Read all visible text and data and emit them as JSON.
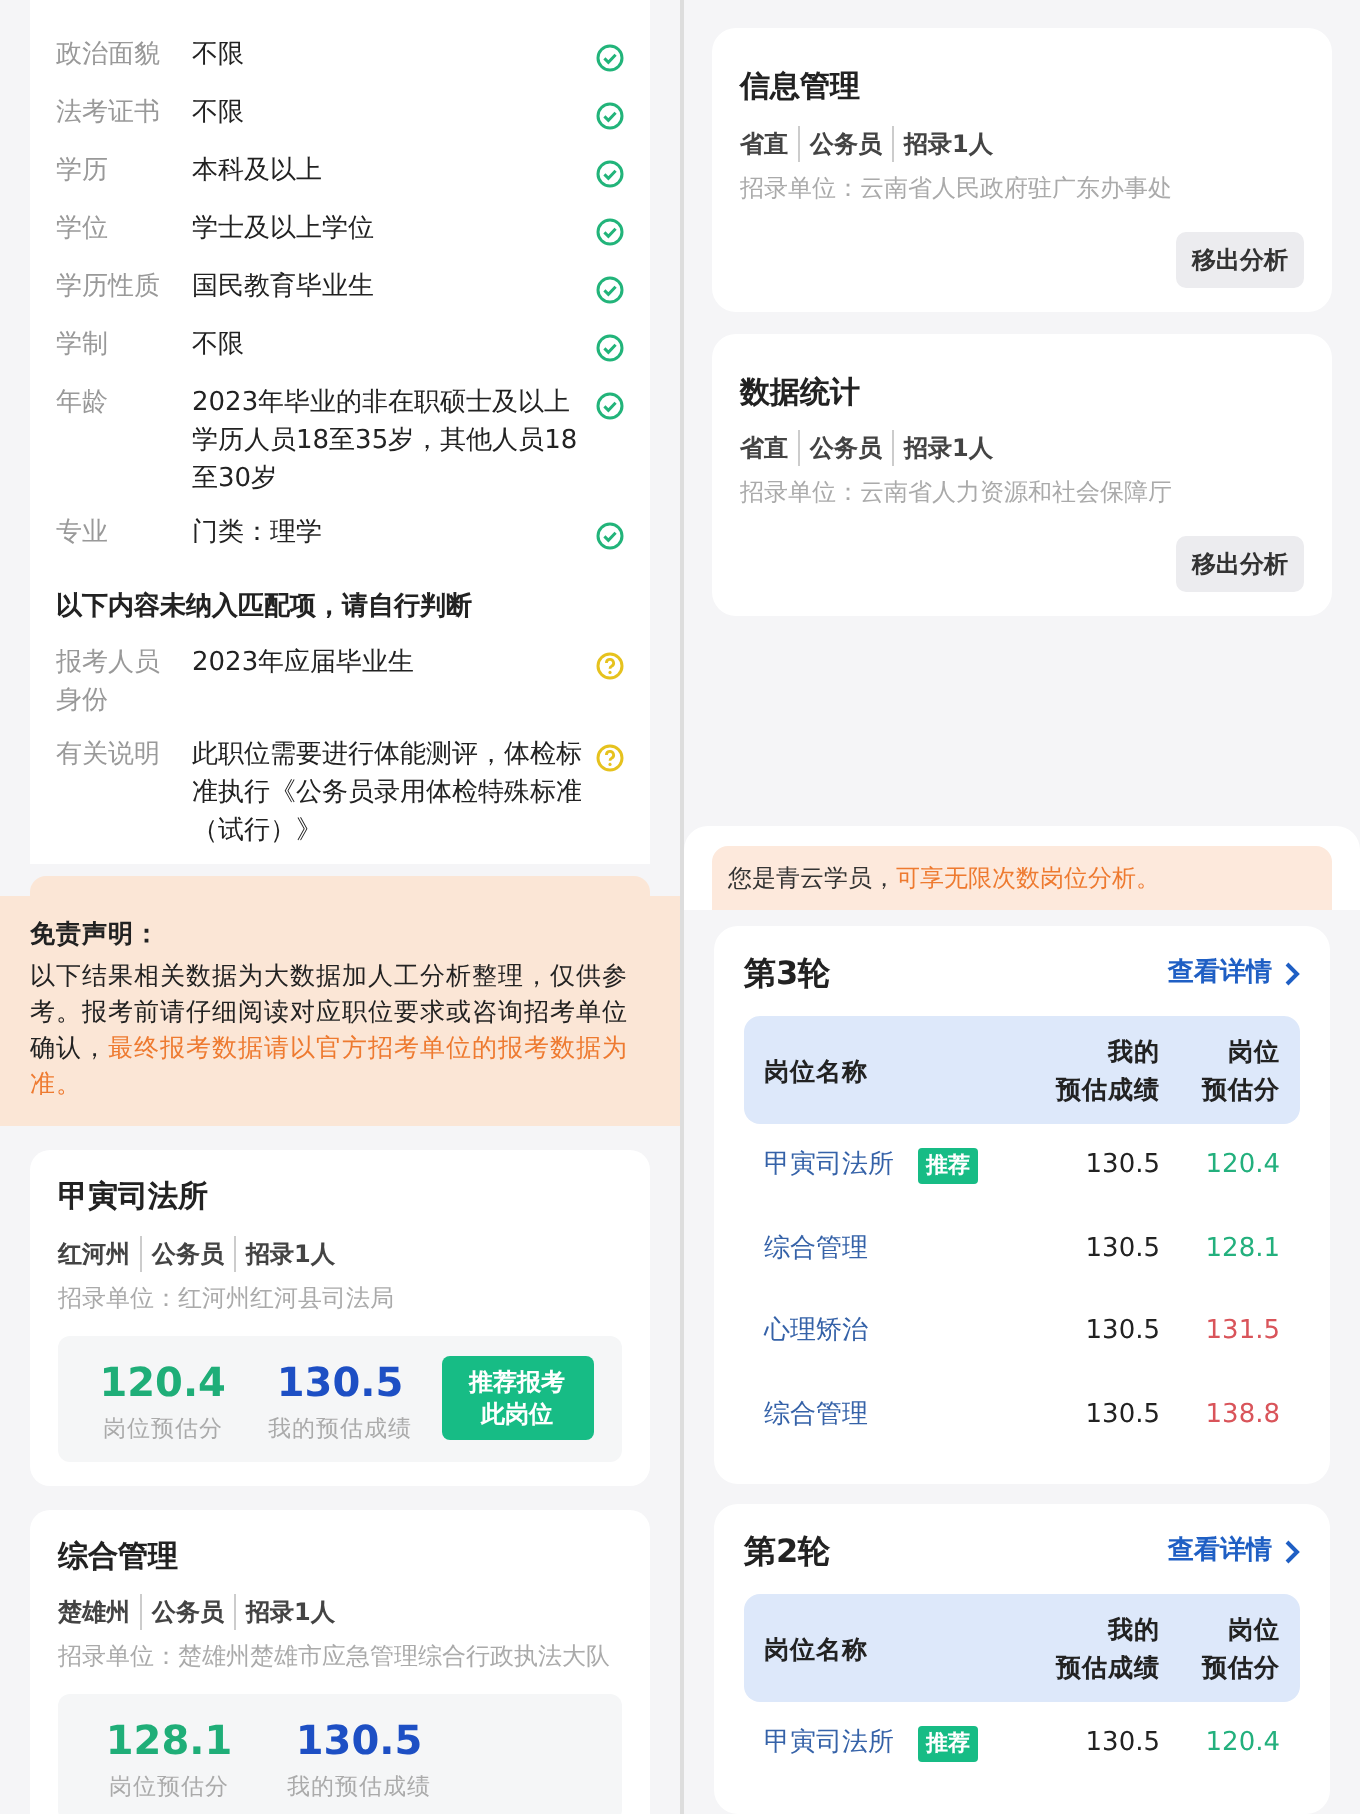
{
  "requirements": {
    "rows": [
      {
        "label": "政治面貌",
        "value": "不限",
        "matched": true
      },
      {
        "label": "法考证书",
        "value": "不限",
        "matched": true
      },
      {
        "label": "学历",
        "value": "本科及以上",
        "matched": true
      },
      {
        "label": "学位",
        "value": "学士及以上学位",
        "matched": true
      },
      {
        "label": "学历性质",
        "value": "国民教育毕业生",
        "matched": true
      },
      {
        "label": "学制",
        "value": "不限",
        "matched": true
      },
      {
        "label": "年龄",
        "value": "2023年毕业的非在职硕士及以上学历人员18至35岁，其他人员18至30岁",
        "matched": true
      },
      {
        "label": "专业",
        "value": "门类：理学",
        "matched": true
      }
    ],
    "notice": "以下内容未纳入匹配项，请自行判断",
    "unmatched_rows": [
      {
        "label": "报考人员身份",
        "value": "2023年应届毕业生",
        "matched": false
      },
      {
        "label": "有关说明",
        "value": "此职位需要进行体能测评，体检标准执行《公务员录用体检特殊标准（试行）》",
        "matched": false
      }
    ]
  },
  "analysis": {
    "cards": [
      {
        "title": "信息管理",
        "tags": [
          "省直",
          "公务员",
          "招录1人"
        ],
        "unit": "招录单位：云南省人民政府驻广东办事处",
        "button": "移出分析"
      },
      {
        "title": "数据统计",
        "tags": [
          "省直",
          "公务员",
          "招录1人"
        ],
        "unit": "招录单位：云南省人力资源和社会保障厅",
        "button": "移出分析"
      }
    ],
    "banner": {
      "text": "您是青云学员，",
      "highlight": "可享无限次数岗位分析。"
    }
  },
  "disclaimer": {
    "title": "免责声明：",
    "text": "以下结果相关数据为大数据加人工分析整理，仅供参考。报考前请仔细阅读对应职位要求或咨询招考单位确认，",
    "highlight": "最终报考数据请以官方招考单位的报考数据为准。"
  },
  "results": [
    {
      "title": "甲寅司法所",
      "tags": [
        "红河州",
        "公务员",
        "招录1人"
      ],
      "unit": "招录单位：红河州红河县司法局",
      "position_score": "120.4",
      "position_label": "岗位预估分",
      "my_score": "130.5",
      "my_label": "我的预估成绩",
      "button": "推荐报考此岗位"
    },
    {
      "title": "综合管理",
      "tags": [
        "楚雄州",
        "公务员",
        "招录1人"
      ],
      "unit": "招录单位：楚雄州楚雄市应急管理综合行政执法大队",
      "position_score": "128.1",
      "position_label": "岗位预估分",
      "my_score": "130.5",
      "my_label": "我的预估成绩"
    }
  ],
  "rounds": [
    {
      "title": "第3轮",
      "link": "查看详情",
      "columns": [
        [
          "岗位名称"
        ],
        [
          "我的",
          "预估成绩"
        ],
        [
          "岗位",
          "预估分"
        ]
      ],
      "rows": [
        {
          "name": "甲寅司法所",
          "badge": "推荐",
          "my_score": "130.5",
          "position_score": "120.4",
          "color": "#23b07d"
        },
        {
          "name": "综合管理",
          "my_score": "130.5",
          "position_score": "128.1",
          "color": "#23b07d"
        },
        {
          "name": "心理矫治",
          "my_score": "130.5",
          "position_score": "131.5",
          "color": "#d9545a"
        },
        {
          "name": "综合管理",
          "my_score": "130.5",
          "position_score": "138.8",
          "color": "#d9545a"
        }
      ]
    },
    {
      "title": "第2轮",
      "link": "查看详情",
      "columns": [
        [
          "岗位名称"
        ],
        [
          "我的",
          "预估成绩"
        ],
        [
          "岗位",
          "预估分"
        ]
      ],
      "rows": [
        {
          "name": "甲寅司法所",
          "badge": "推荐",
          "my_score": "130.5",
          "position_score": "120.4",
          "color": "#23b07d"
        }
      ]
    }
  ]
}
